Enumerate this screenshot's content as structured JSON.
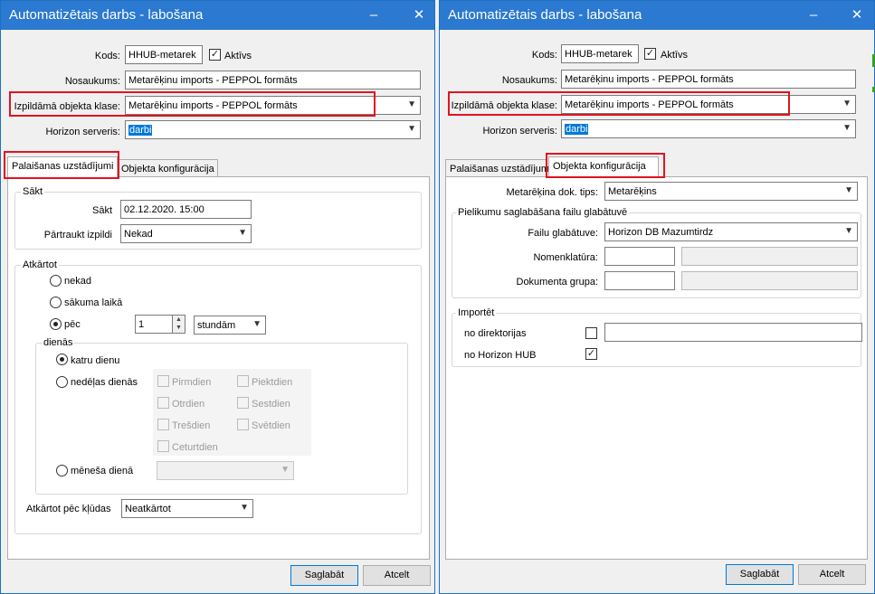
{
  "left": {
    "title": "Automatizētais darbs - labošana",
    "fields": {
      "kods_label": "Kods:",
      "kods_value": "HHUB-metarek",
      "aktivs_label": "Aktīvs",
      "nosaukums_label": "Nosaukums:",
      "nosaukums_value": "Metarēķinu imports - PEPPOL formāts",
      "klase_label": "Izpildāmā objekta klase:",
      "klase_value": "Metarēķinu imports - PEPPOL formāts",
      "server_label": "Horizon serveris:",
      "server_value": "darbi"
    },
    "tabs": [
      "Palaišanas uzstādījumi",
      "Objekta konfigurācija"
    ],
    "sakt_group": "Sākt",
    "sakt_label": "Sākt",
    "sakt_value": "02.12.2020. 15:00",
    "partraukt_label": "Pārtraukt izpildi",
    "partraukt_value": "Nekad",
    "atkartot_group": "Atkārtot",
    "opt_nekad": "nekad",
    "opt_sakuma": "sākuma laikā",
    "opt_pec": "pēc",
    "pec_value": "1",
    "pec_unit": "stundām",
    "dienas_group": "dienās",
    "opt_katru": "katru dienu",
    "opt_nedelas": "nedēļas dienās",
    "days": [
      "Pirmdien",
      "Otrdien",
      "Trešdien",
      "Ceturtdien",
      "Piektdien",
      "Sestdien",
      "Svētdien"
    ],
    "opt_menesa": "mēneša dienā",
    "kludas_label": "Atkārtot pēc kļūdas",
    "kludas_value": "Neatkārtot",
    "save": "Saglabāt",
    "cancel": "Atcelt"
  },
  "right": {
    "title": "Automatizētais darbs - labošana",
    "fields": {
      "kods_label": "Kods:",
      "kods_value": "HHUB-metarek",
      "aktivs_label": "Aktīvs",
      "nosaukums_label": "Nosaukums:",
      "nosaukums_value": "Metarēķinu imports - PEPPOL formāts",
      "klase_label": "Izpildāmā objekta klase:",
      "klase_value": "Metarēķinu imports - PEPPOL formāts",
      "server_label": "Horizon serveris:",
      "server_value": "darbi"
    },
    "tabs": [
      "Palaišanas uzstādījumi",
      "Objekta konfigurācija"
    ],
    "dok_tips_label": "Metarēķina dok. tips:",
    "dok_tips_value": "Metarēķins",
    "pielikumu_group": "Pielikumu saglabāšana failu glabātuvē",
    "glabatuve_label": "Failu glabātuve:",
    "glabatuve_value": "Horizon DB Mazumtirdz",
    "nomenklatura_label": "Nomenklatūra:",
    "dok_grupa_label": "Dokumenta grupa:",
    "importet_group": "Importēt",
    "no_dir_label": "no direktorijas",
    "no_hub_label": "no Horizon HUB",
    "save": "Saglabāt",
    "cancel": "Atcelt"
  },
  "colors": {
    "titlebar": "#2b79d0",
    "highlight_box": "#e0141f",
    "selection": "#0078d7"
  }
}
